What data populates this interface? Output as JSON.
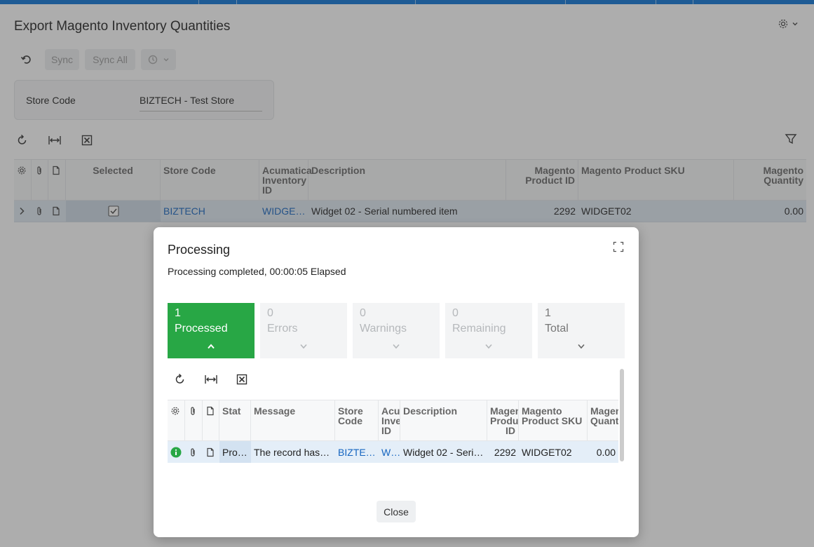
{
  "page": {
    "title": "Export Magento Inventory Quantities"
  },
  "toolbar": {
    "sync_label": "Sync",
    "sync_all_label": "Sync All"
  },
  "form": {
    "store_code_label": "Store Code",
    "store_code_value": "BIZTECH - Test Store"
  },
  "grid": {
    "columns": {
      "selected": "Selected",
      "store_code": "Store Code",
      "acumatica_inventory_id": "Acumatica Inventory ID",
      "description": "Description",
      "magento_product_id": "Magento Product ID",
      "magento_product_sku": "Magento Product SKU",
      "magento_quantity": "Magento Quantity"
    },
    "rows": [
      {
        "selected": true,
        "store_code": "BIZTECH",
        "acumatica_inventory_id": "WIDGE…",
        "description": "Widget 02 - Serial numbered item",
        "magento_product_id": "2292",
        "magento_product_sku": "WIDGET02",
        "magento_quantity": "0.00"
      }
    ]
  },
  "modal": {
    "title": "Processing",
    "status_text": "Processing completed, 00:00:05 Elapsed",
    "cards": [
      {
        "count": "1",
        "label": "Processed",
        "active": true
      },
      {
        "count": "0",
        "label": "Errors",
        "active": false
      },
      {
        "count": "0",
        "label": "Warnings",
        "active": false
      },
      {
        "count": "0",
        "label": "Remaining",
        "active": false
      },
      {
        "count": "1",
        "label": "Total",
        "active": false
      }
    ],
    "grid": {
      "columns": {
        "status": "Stat",
        "message": "Message",
        "store_code": "Store Code",
        "acumatica_inventory_id": "Acu Inve ID",
        "description": "Description",
        "magento_product_id": "Magen Produ ID",
        "magento_product_sku": "Magento Product SKU",
        "magento_quantity": "Magen Quant"
      },
      "rows": [
        {
          "status": "Pro…",
          "message": "The record has…",
          "store_code": "BIZTE…",
          "acumatica_inventory_id": "W…",
          "description": "Widget 02 - Seri…",
          "magento_product_id": "2292",
          "magento_product_sku": "WIDGET02",
          "magento_quantity": "0.00"
        }
      ]
    },
    "close_label": "Close"
  },
  "colors": {
    "accent": "#0a73d6",
    "success": "#28a745",
    "link": "#1565c0"
  }
}
